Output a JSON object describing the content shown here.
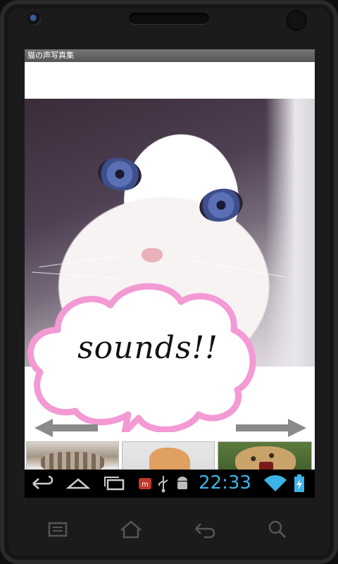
{
  "app": {
    "title": "猫の声写真集"
  },
  "bubble": {
    "text": "sounds!!"
  },
  "status_bar": {
    "time": "22:33",
    "icons": [
      "back-icon",
      "home-icon",
      "recent-apps-icon",
      "app-notification-icon",
      "usb-icon",
      "android-debug-icon",
      "wifi-icon",
      "battery-charging-icon"
    ]
  },
  "thumbnails": [
    "sleeping-cat",
    "orange-kitten",
    "serval-hissing"
  ],
  "hardware_buttons": [
    "menu-icon",
    "home-icon",
    "back-icon",
    "search-icon"
  ],
  "colors": {
    "bubble_border": "#f39ad4",
    "clock": "#3cb4e8",
    "arrow": "#8a8a8a"
  }
}
